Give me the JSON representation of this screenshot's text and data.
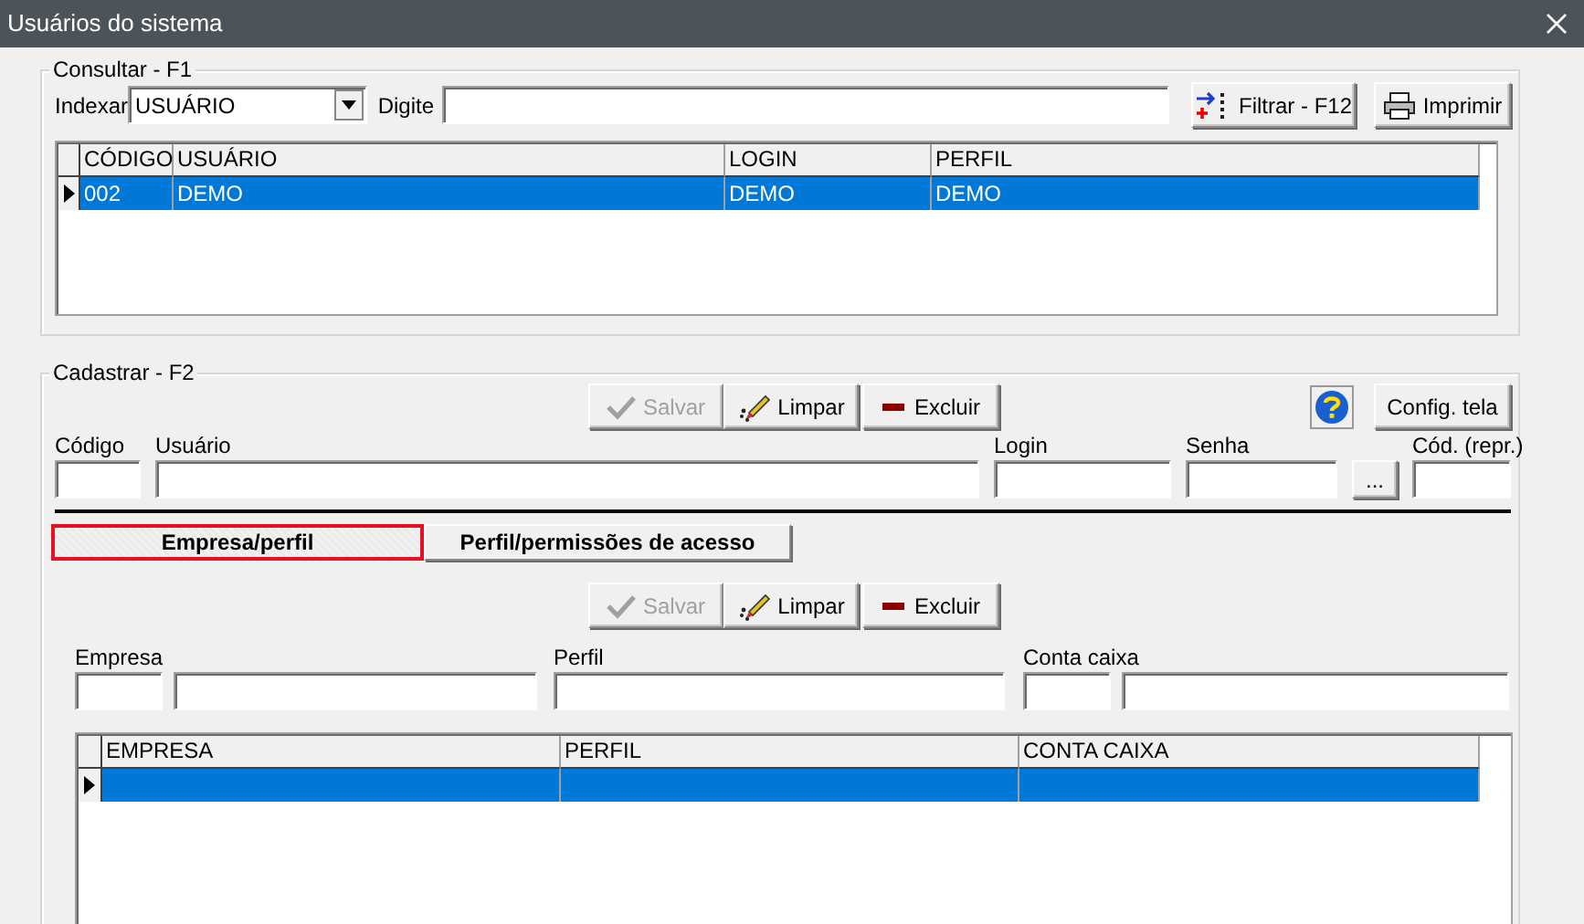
{
  "window": {
    "title": "Usuários do sistema"
  },
  "consultar": {
    "legend": "Consultar - F1",
    "index_label": "Indexar",
    "index_value": "USUÁRIO",
    "search_label": "Digite",
    "buttons": [
      {
        "label": "Filtrar - F12",
        "kind": "filter"
      },
      {
        "label": "Imprimir",
        "kind": "print"
      }
    ],
    "table": {
      "columns": [
        "CÓDIGO",
        "USUÁRIO",
        "LOGIN",
        "PERFIL"
      ],
      "rows": [
        {
          "cells": [
            "002",
            "DEMO",
            "DEMO",
            "DEMO"
          ],
          "selected": true
        }
      ]
    }
  },
  "cadastrar": {
    "legend": "Cadastrar - F2",
    "actions": [
      {
        "label": "Salvar",
        "kind": "save",
        "disabled": true
      },
      {
        "label": "Limpar",
        "kind": "clear",
        "disabled": false
      },
      {
        "label": "Excluir",
        "kind": "delete",
        "disabled": false
      }
    ],
    "config_button": "Config. tela",
    "fields": [
      {
        "label": "Código"
      },
      {
        "label": "Usuário"
      },
      {
        "label": "Login"
      },
      {
        "label": "Senha",
        "browse": "..."
      },
      {
        "label": "Cód. (repr.)"
      }
    ],
    "tabs": [
      {
        "label": "Empresa/perfil",
        "selected": true
      },
      {
        "label": "Perfil/permissões de acesso",
        "selected": false
      }
    ],
    "detail": {
      "actions": [
        {
          "label": "Salvar",
          "kind": "save",
          "disabled": true
        },
        {
          "label": "Limpar",
          "kind": "clear",
          "disabled": false
        },
        {
          "label": "Excluir",
          "kind": "delete",
          "disabled": false
        }
      ],
      "fields": [
        {
          "label": "Empresa",
          "kind": "pair"
        },
        {
          "label": "Perfil",
          "kind": "single"
        },
        {
          "label": "Conta caixa",
          "kind": "pair"
        }
      ],
      "table": {
        "columns": [
          "EMPRESA",
          "PERFIL",
          "CONTA CAIXA"
        ],
        "rows": [
          {
            "selected": true
          }
        ]
      }
    }
  }
}
